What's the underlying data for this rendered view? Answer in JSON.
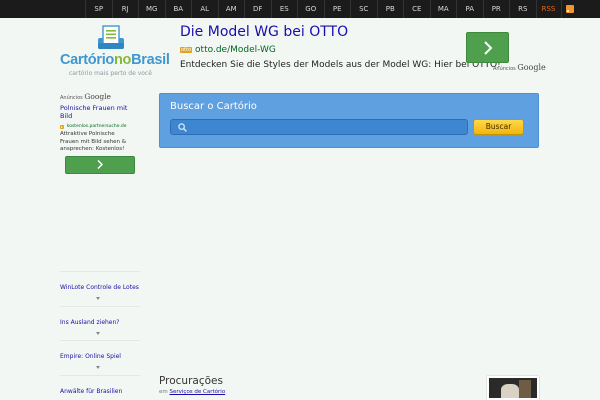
{
  "states": [
    "SP",
    "RJ",
    "MG",
    "BA",
    "AL",
    "AM",
    "DF",
    "ES",
    "GO",
    "PE",
    "SC",
    "PB",
    "CE",
    "MA",
    "PA",
    "PR",
    "RS"
  ],
  "rss_label": "RSS",
  "logo": {
    "name_part1": "Cartório",
    "name_part2": "no",
    "name_part3": "Brasil",
    "tagline": "cartório mais perto de você"
  },
  "top_ad": {
    "title": "Die Model WG bei OTTO",
    "badge": "otto",
    "url": "otto.de/Model-WG",
    "description": "Entdecken Sie die Styles der Models aus der Model WG: Hier bei OTTO!",
    "anuncios": "Anúncios",
    "google": "Google"
  },
  "side_ad": {
    "anuncios": "Anúncios",
    "google": "Google",
    "title": "Polnische Frauen mit Bild",
    "url": "kostenlos.partnersuche.de",
    "description": "Attraktive Polnische Frauen mit Bild sehen & ansprechen: Kostenlos!"
  },
  "search": {
    "heading": "Buscar o Cartório",
    "placeholder": "",
    "button": "Buscar"
  },
  "side_links": [
    "WinLote Controle de Lotes",
    "Ins Ausland ziehen?",
    "Empire: Online Spiel",
    "Anwälte für Brasilien"
  ],
  "article": {
    "title": "Procurações",
    "meta_prefix": "em",
    "category": "Serviços de Cartório"
  },
  "colors": {
    "topbar": "#1b1b1b",
    "search_panel": "#5fa0e0",
    "search_button": "#f2b50d",
    "ad_button": "#4ea04e",
    "logo_blue": "#3f97cf",
    "logo_green": "#86b83a"
  }
}
